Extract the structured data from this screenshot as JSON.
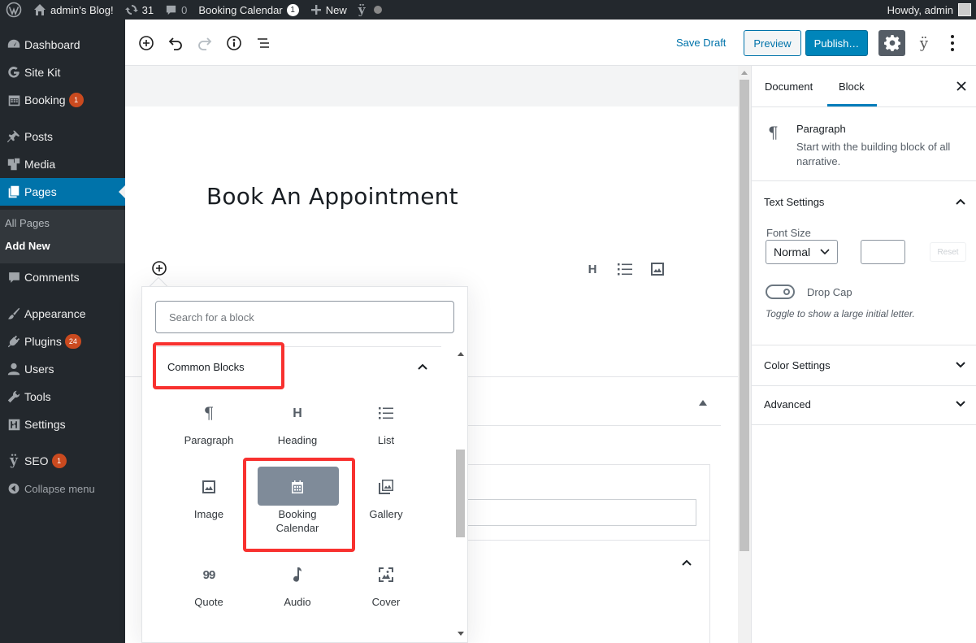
{
  "adminbar": {
    "site_name": "admin's Blog!",
    "updates_count": "31",
    "comments_count": "0",
    "booking_calendar_label": "Booking Calendar",
    "booking_calendar_count": "1",
    "new_label": "New",
    "howdy": "Howdy, admin"
  },
  "menu": {
    "dashboard": "Dashboard",
    "site_kit": "Site Kit",
    "booking": "Booking",
    "booking_count": "1",
    "posts": "Posts",
    "media": "Media",
    "pages": "Pages",
    "all_pages": "All Pages",
    "add_new": "Add New",
    "comments": "Comments",
    "appearance": "Appearance",
    "plugins": "Plugins",
    "plugins_count": "24",
    "users": "Users",
    "tools": "Tools",
    "settings": "Settings",
    "seo": "SEO",
    "seo_count": "1",
    "collapse": "Collapse menu"
  },
  "header": {
    "save_draft": "Save Draft",
    "preview": "Preview",
    "publish": "Publish…"
  },
  "editor": {
    "post_title": "Book An Appointment",
    "toolbar_heading": "H"
  },
  "inserter": {
    "search_placeholder": "Search for a block",
    "section_title": "Common Blocks",
    "blocks": {
      "paragraph": "Paragraph",
      "heading": "Heading",
      "list": "List",
      "image": "Image",
      "booking_calendar": "Booking Calendar",
      "gallery": "Gallery",
      "quote": "Quote",
      "audio": "Audio",
      "cover": "Cover"
    },
    "paragraph_glyph": "¶",
    "heading_glyph": "H",
    "quote_glyph": "99"
  },
  "sidebar": {
    "tab_document": "Document",
    "tab_block": "Block",
    "block_name": "Paragraph",
    "block_description": "Start with the building block of all narrative.",
    "text_settings": "Text Settings",
    "font_size_label": "Font Size",
    "font_size_value": "Normal",
    "reset": "Reset",
    "drop_cap": "Drop Cap",
    "drop_cap_help": "Toggle to show a large initial letter.",
    "color_settings": "Color Settings",
    "advanced": "Advanced"
  },
  "colors": {
    "admin_dark": "#23282d",
    "wp_blue": "#0073aa",
    "publish_blue": "#0085ba",
    "highlight_red": "#f8312f",
    "badge_orange": "#ca4a1f"
  }
}
